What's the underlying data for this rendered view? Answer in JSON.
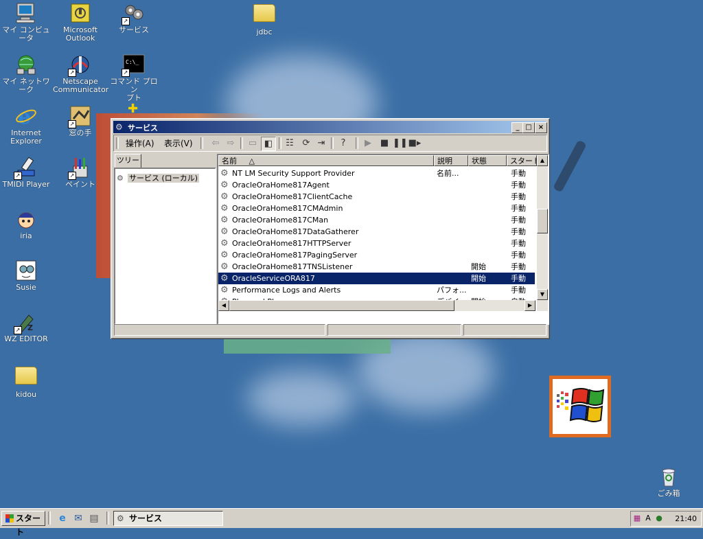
{
  "desktop": {
    "icons": [
      {
        "id": "my-computer",
        "label": "マイ コンピュータ",
        "icon": "computer-icon"
      },
      {
        "id": "outlook",
        "label": "Microsoft\nOutlook",
        "icon": "outlook-icon"
      },
      {
        "id": "services",
        "label": "サービス",
        "icon": "services-icon"
      },
      {
        "id": "jdbc",
        "label": "jdbc",
        "icon": "folder-icon"
      },
      {
        "id": "my-network",
        "label": "マイ ネットワーク",
        "icon": "network-icon"
      },
      {
        "id": "netscape",
        "label": "Netscape\nCommunicator",
        "icon": "netscape-icon"
      },
      {
        "id": "cmd",
        "label": "コマンド プロン\nプト",
        "icon": "command-prompt-icon"
      },
      {
        "id": "ie",
        "label": "Internet\nExplorer",
        "icon": "ie-icon"
      },
      {
        "id": "madonote",
        "label": "窓の手",
        "icon": "madonote-icon"
      },
      {
        "id": "tmidi",
        "label": "TMIDI Player",
        "icon": "tmidi-icon"
      },
      {
        "id": "paint",
        "label": "ペイント",
        "icon": "paint-icon"
      },
      {
        "id": "iria",
        "label": "iria",
        "icon": "iria-icon"
      },
      {
        "id": "susie",
        "label": "Susie",
        "icon": "susie-icon"
      },
      {
        "id": "wzeditor",
        "label": "WZ EDITOR",
        "icon": "wz-editor-icon"
      },
      {
        "id": "kidou",
        "label": "kidou",
        "icon": "folder-icon"
      },
      {
        "id": "recycle",
        "label": "ごみ箱",
        "icon": "recycle-bin-icon"
      }
    ]
  },
  "window": {
    "title": "サービス",
    "controls": {
      "minimize": "_",
      "maximize": "□",
      "close": "×"
    },
    "menu": {
      "action": "操作(A)",
      "view": "表示(V)"
    },
    "tree": {
      "tab": "ツリー",
      "root": "サービス (ローカル)"
    },
    "columns": [
      "名前",
      "説明",
      "状態",
      "スタート"
    ],
    "sort_indicator": "△",
    "services": [
      {
        "name": "NT LM Security Support Provider",
        "desc": "名前...",
        "status": "",
        "startup": "手動"
      },
      {
        "name": "OracleOraHome817Agent",
        "desc": "",
        "status": "",
        "startup": "手動"
      },
      {
        "name": "OracleOraHome817ClientCache",
        "desc": "",
        "status": "",
        "startup": "手動"
      },
      {
        "name": "OracleOraHome817CMAdmin",
        "desc": "",
        "status": "",
        "startup": "手動"
      },
      {
        "name": "OracleOraHome817CMan",
        "desc": "",
        "status": "",
        "startup": "手動"
      },
      {
        "name": "OracleOraHome817DataGatherer",
        "desc": "",
        "status": "",
        "startup": "手動"
      },
      {
        "name": "OracleOraHome817HTTPServer",
        "desc": "",
        "status": "",
        "startup": "手動"
      },
      {
        "name": "OracleOraHome817PagingServer",
        "desc": "",
        "status": "",
        "startup": "手動"
      },
      {
        "name": "OracleOraHome817TNSListener",
        "desc": "",
        "status": "開始",
        "startup": "手動"
      },
      {
        "name": "OracleServiceORA817",
        "desc": "",
        "status": "開始",
        "startup": "手動",
        "selected": true
      },
      {
        "name": "Performance Logs and Alerts",
        "desc": "パフォ...",
        "status": "",
        "startup": "手動"
      },
      {
        "name": "Plug and Play",
        "desc": "デバイ...",
        "status": "開始",
        "startup": "自動"
      }
    ]
  },
  "taskbar": {
    "start_label": "スタート",
    "active_task": "サービス",
    "clock": "21:40",
    "tray_ime": "A"
  },
  "colors": {
    "desktop": "#3a6ea5",
    "title_active": "#0a246a",
    "selection": "#0a246a",
    "face": "#d4d0c8"
  }
}
